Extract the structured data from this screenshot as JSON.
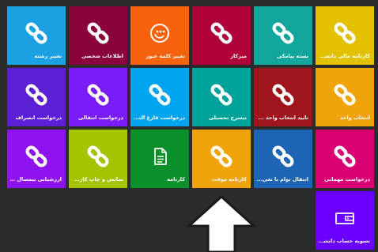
{
  "tiles": [
    {
      "label": "کارنامه مالی دانشجو",
      "color": "#e2c100",
      "icon": "link-icon"
    },
    {
      "label": "بسته پیامکی",
      "color": "#12a59c",
      "icon": "link-icon"
    },
    {
      "label": "میزکار",
      "color": "#b0003a",
      "icon": "link-icon"
    },
    {
      "label": "تغییر کلمه عبور",
      "color": "#f7630c",
      "icon": "key-refresh-icon"
    },
    {
      "label": "اطلاعات شخصی",
      "color": "#8a0038",
      "icon": "link-icon"
    },
    {
      "label": "تغییر رشته",
      "color": "#1ba1e2",
      "icon": "link-icon"
    },
    {
      "label": "انتخاب واحد",
      "color": "#f0a30a",
      "icon": "link-icon"
    },
    {
      "label": "تایید انتخاب واحد ...",
      "color": "#a0151d",
      "icon": "link-icon"
    },
    {
      "label": "تیسرح تحصیلی",
      "color": "#00a39a",
      "icon": "link-icon"
    },
    {
      "label": "درخواست فارغ التحصی...",
      "color": "#00a4ef",
      "icon": "link-icon"
    },
    {
      "label": "درخواست انتقالی",
      "color": "#7a1cf7",
      "icon": "link-icon"
    },
    {
      "label": "درخواست انصراف",
      "color": "#5b1fd6",
      "icon": "link-icon"
    },
    {
      "label": "درخواست مهمانی",
      "color": "#d80073",
      "icon": "link-icon"
    },
    {
      "label": "انتقال توام با تغی...",
      "color": "#1e64b4",
      "icon": "link-icon"
    },
    {
      "label": "کارنامه موقت",
      "color": "#f0a30a",
      "icon": "link-icon"
    },
    {
      "label": "کارنامه",
      "color": "#0a8f2a",
      "icon": "document-icon"
    },
    {
      "label": "نمایش و چاپ کارت ت...",
      "color": "#a4c400",
      "icon": "link-icon"
    },
    {
      "label": "ارزشیابی نیمسال جاری",
      "color": "#8e13ee",
      "icon": "link-icon"
    },
    {
      "label": "تسویه حساب دانشجو",
      "color": "#6a00ff",
      "icon": "wallet-icon"
    }
  ]
}
